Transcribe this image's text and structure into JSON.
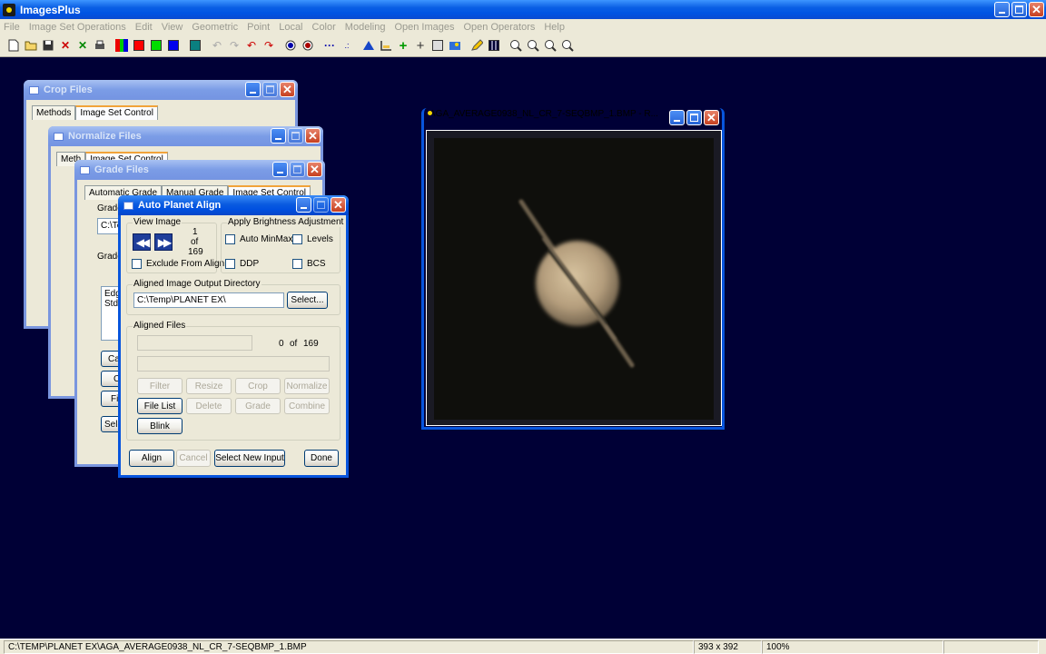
{
  "app": {
    "title": "ImagesPlus"
  },
  "menu": [
    "File",
    "Image Set Operations",
    "Edit",
    "View",
    "Geometric",
    "Point",
    "Local",
    "Color",
    "Modeling",
    "Open Images",
    "Open Operators",
    "Help"
  ],
  "toolbar_icons": [
    "new-file-icon",
    "open-folder-icon",
    "save-icon",
    "delete-icon",
    "clear-icon",
    "print-icon",
    "rgb-channels-icon",
    "red-channel-icon",
    "green-channel-icon",
    "blue-channel-icon",
    "grid-tool-icon",
    "undo-icon",
    "redo-icon",
    "undo-all-icon",
    "redo-all-icon",
    "circle-select-icon",
    "ellipse-select-icon",
    "line-tool-icon",
    "points-tool-icon",
    "histogram-icon",
    "ruler-icon",
    "crosshair-plus-icon",
    "crosshair-icon",
    "info-icon",
    "painter-icon",
    "pencil-icon",
    "mosaic-icon",
    "zoom-in-icon",
    "zoom-out-icon",
    "zoom-fit-icon",
    "zoom-actual-icon"
  ],
  "crop_window": {
    "title": "Crop Files",
    "tab_methods": "Methods",
    "tab_image_set": "Image Set Control"
  },
  "normalize_window": {
    "title": "Normalize Files",
    "tab_methods": "Meth",
    "tab_image_set": "Image Set Control"
  },
  "grade_window": {
    "title": "Grade Files",
    "tab_auto": "Automatic Grade",
    "tab_manual": "Manual Grade",
    "tab_image_set": "Image Set Control",
    "group_grade": "Grade",
    "field_path": "C:\\Tem",
    "group_grade2": "Grade",
    "list_line1": "Edge",
    "list_line2": "StdD",
    "btn_cal": "Cal",
    "btn_c": "C",
    "btn_file": "File",
    "btn_sele": "Sele"
  },
  "align_window": {
    "title": "Auto Planet Align",
    "view_image_label": "View Image",
    "image_index": "1",
    "of_label": "of",
    "image_total": "169",
    "exclude_label": "Exclude From Align",
    "brightness_label": "Apply Brightness Adjustment",
    "auto_minmax": "Auto MinMax",
    "levels": "Levels",
    "ddp": "DDP",
    "bcs": "BCS",
    "output_dir_label": "Aligned Image Output Directory",
    "output_dir_value": "C:\\Temp\\PLANET EX\\",
    "select_btn": "Select...",
    "aligned_files_label": "Aligned Files",
    "aligned_count": "0",
    "aligned_of": "of",
    "aligned_total": "169",
    "progress": 0,
    "btn_filter": "Filter",
    "btn_resize": "Resize",
    "btn_crop": "Crop",
    "btn_normalize": "Normalize",
    "btn_file_list": "File List",
    "btn_delete": "Delete",
    "btn_grade": "Grade",
    "btn_combine": "Combine",
    "btn_blink": "Blink",
    "btn_align": "Align",
    "btn_cancel": "Cancel",
    "btn_select_new_input": "Select New Input",
    "btn_done": "Done"
  },
  "image_window": {
    "title": "AGA_AVERAGE0938_NL_CR_7-SEQBMP_1.BMP - R..."
  },
  "status": {
    "path": "C:\\TEMP\\PLANET EX\\AGA_AVERAGE0938_NL_CR_7-SEQBMP_1.BMP",
    "dimensions": "393 x 392",
    "zoom": "100%"
  }
}
